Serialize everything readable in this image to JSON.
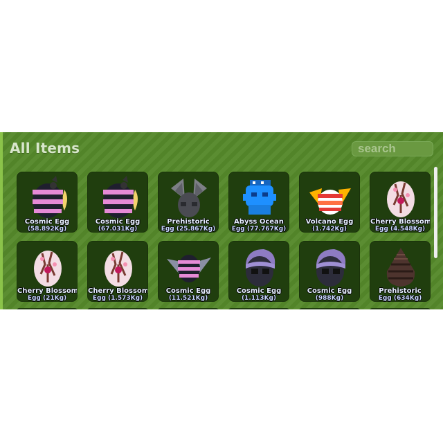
{
  "inventory": {
    "title": "All Items",
    "search_placeholder": "search",
    "items": [
      {
        "name": "Cosmic Egg",
        "weight": "(58.892Kg)",
        "icon": "cosmic-egg-striped-icon"
      },
      {
        "name": "Cosmic Egg",
        "weight": "(67.031Kg)",
        "icon": "cosmic-egg-striped-icon"
      },
      {
        "name": "Prehistoric",
        "weight": "Egg (25.867Kg)",
        "icon": "prehistoric-egg-winged-icon"
      },
      {
        "name": "Abyss Ocean",
        "weight": "Egg (77.767Kg)",
        "icon": "abyss-ocean-egg-icon"
      },
      {
        "name": "Volcano Egg",
        "weight": "(1.742Kg)",
        "icon": "volcano-egg-icon"
      },
      {
        "name": "Cherry Blossom",
        "weight": "Egg (4.548Kg)",
        "icon": "cherry-blossom-egg-icon"
      },
      {
        "name": "Cherry Blossom",
        "weight": "Egg (21Kg)",
        "icon": "cherry-blossom-egg-icon"
      },
      {
        "name": "Cherry Blossom",
        "weight": "Egg (1.573Kg)",
        "icon": "cherry-blossom-egg-icon"
      },
      {
        "name": "Cosmic Egg",
        "weight": "(11.521Kg)",
        "icon": "cosmic-egg-winged-icon"
      },
      {
        "name": "Cosmic Egg",
        "weight": "(1.113Kg)",
        "icon": "cosmic-egg-purple-icon"
      },
      {
        "name": "Cosmic Egg",
        "weight": "(988Kg)",
        "icon": "cosmic-egg-purple-icon"
      },
      {
        "name": "Prehistoric",
        "weight": "Egg (634Kg)",
        "icon": "prehistoric-egg-brown-icon"
      }
    ]
  },
  "colors": {
    "panel": "#55892a",
    "card": "#203e0e",
    "label": "#e6f0ff"
  }
}
